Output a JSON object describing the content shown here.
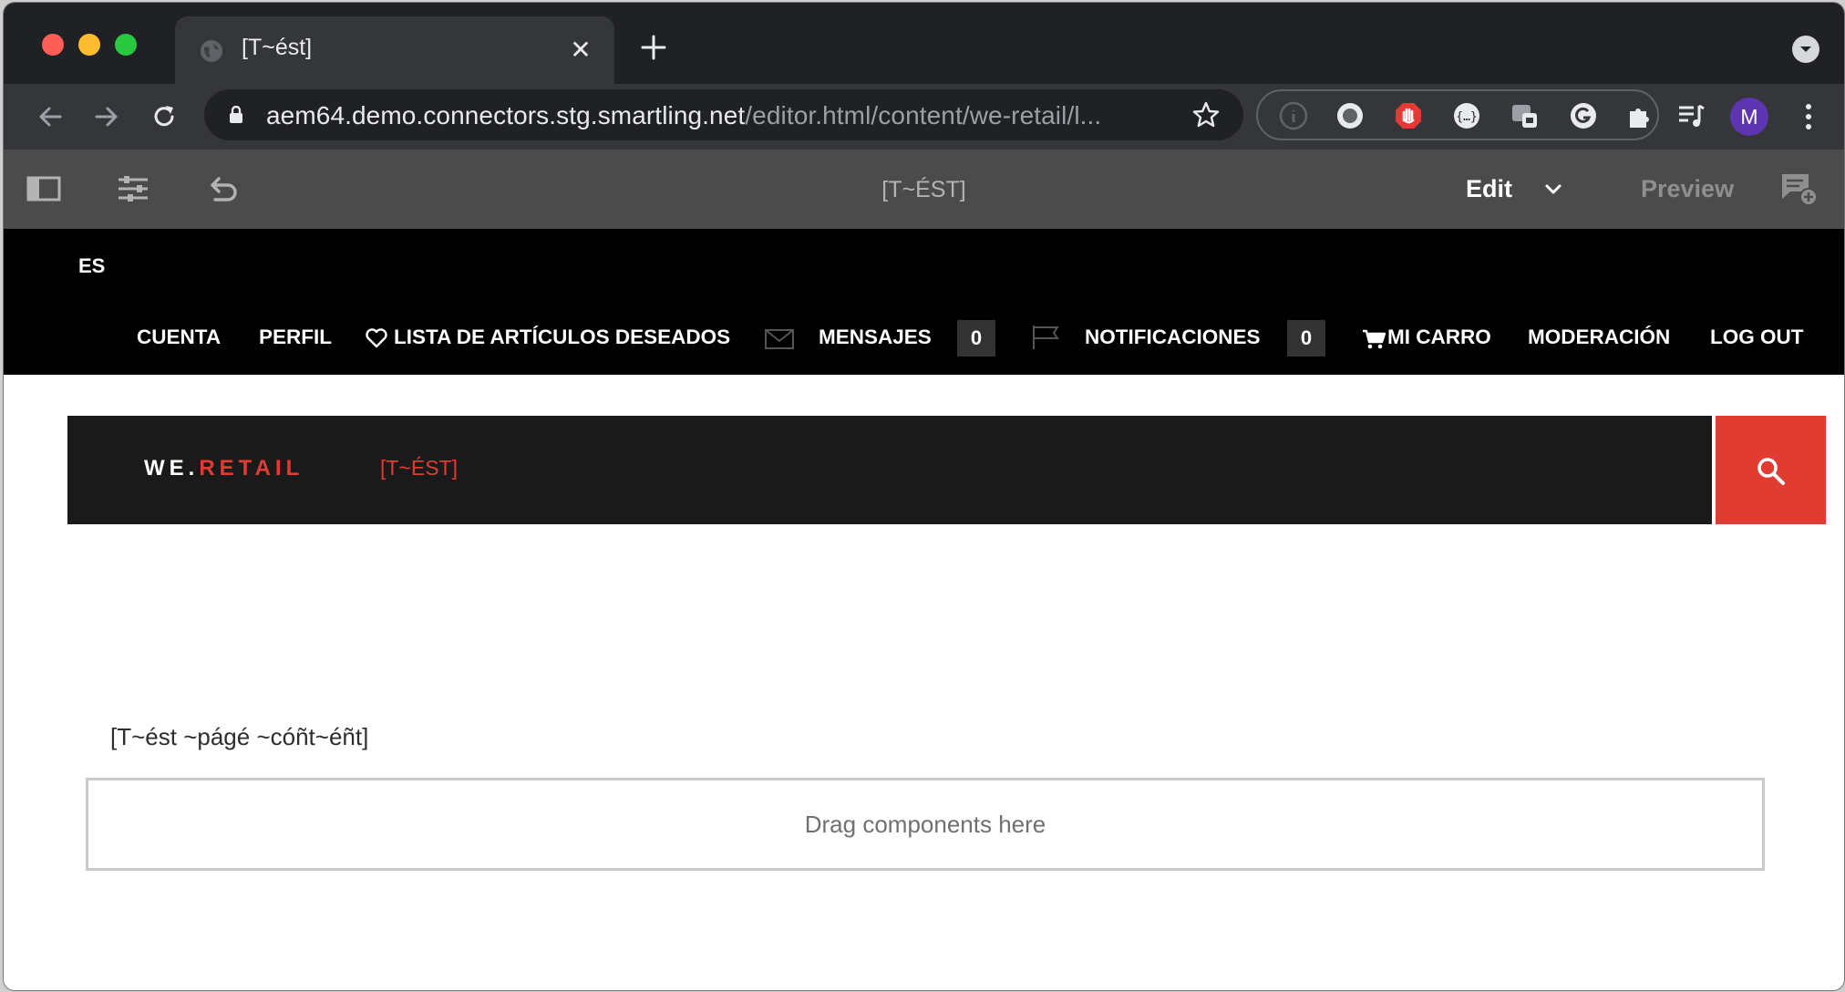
{
  "browser": {
    "tab": {
      "title": "[T~ést]"
    },
    "address": {
      "host": "aem64.demo.connectors.stg.smartling.net",
      "path": "/editor.html/content/we-retail/l..."
    },
    "profile_initial": "M",
    "colors": {
      "frame": "#202124",
      "toolbar": "#35363a",
      "avatar": "#5e35b1"
    }
  },
  "editor": {
    "page_title": "[T~ÉST]",
    "mode_label": "Edit",
    "preview_label": "Preview"
  },
  "site": {
    "language": "ES",
    "nav": {
      "account": "CUENTA",
      "profile": "PERFIL",
      "wishlist": "LISTA DE ARTÍCULOS DESEADOS",
      "messages": "MENSAJES",
      "messages_count": "0",
      "notifications": "NOTIFICACIONES",
      "notifications_count": "0",
      "cart": "MI CARRO",
      "moderation": "MODERACIÓN",
      "logout": "LOG OUT"
    },
    "brand": {
      "we": "WE",
      "dot": ".",
      "retail": "RETAIL",
      "link": "[T~ÉST]"
    },
    "colors": {
      "accent": "#e03c31",
      "nav_bg": "#000000",
      "header_bg": "#1a1a1a"
    }
  },
  "content": {
    "text": "[T~ést ~págé ~cóñt~éñt]",
    "dropzone": "Drag components here"
  }
}
